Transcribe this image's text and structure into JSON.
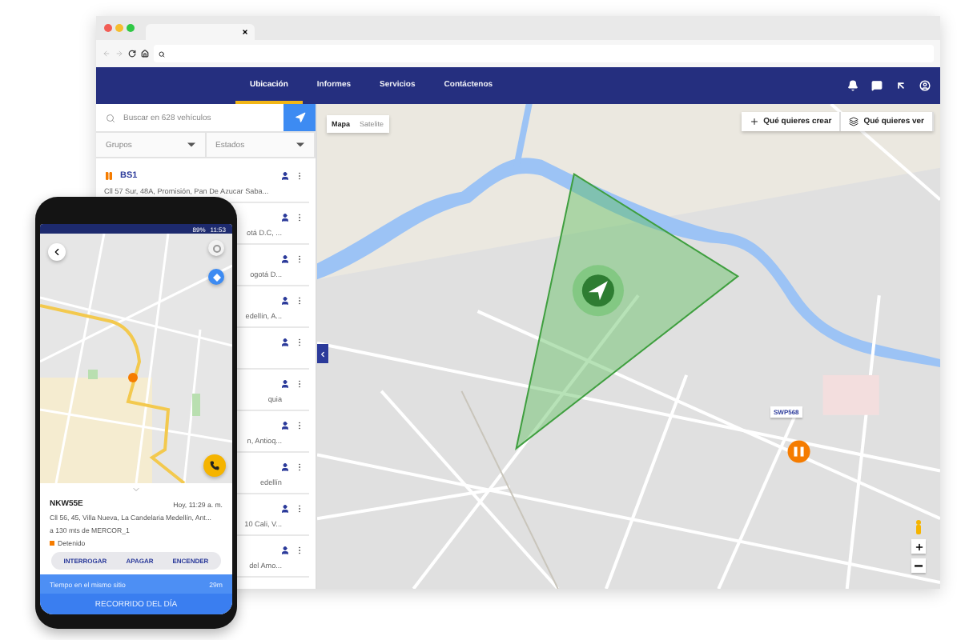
{
  "nav": {
    "items": [
      {
        "label": "Ubicación",
        "selected": true
      },
      {
        "label": "Informes",
        "selected": false
      },
      {
        "label": "Servicios",
        "selected": false
      },
      {
        "label": "Contáctenos",
        "selected": false
      }
    ]
  },
  "sidebar": {
    "search": {
      "placeholder": "Buscar en 628 vehículos"
    },
    "filters": [
      "Grupos",
      "Estados"
    ],
    "vehicles": [
      {
        "kind": "named",
        "name": "BS1",
        "address": "Cll 57 Sur, 48A, Promisión, Pan De Azucar Saba..."
      },
      {
        "kind": "covered",
        "address": "otá D.C, ..."
      },
      {
        "kind": "covered",
        "address": "ogotá D..."
      },
      {
        "kind": "covered",
        "address": "edellín, A..."
      },
      {
        "kind": "covered"
      },
      {
        "kind": "covered",
        "address": "quia"
      },
      {
        "kind": "covered",
        "address": "n, Antioq..."
      },
      {
        "kind": "covered",
        "address": "edellín"
      },
      {
        "kind": "covered",
        "address": "10 Cali, V..."
      },
      {
        "kind": "covered",
        "address": "del Amo..."
      }
    ]
  },
  "map": {
    "modes": [
      {
        "label": "Mapa",
        "selected": true
      },
      {
        "label": "Satelite",
        "selected": false
      }
    ],
    "actions": [
      {
        "kind": "create",
        "label": "Qué quieres crear"
      },
      {
        "kind": "view",
        "label": "Qué quieres ver"
      }
    ],
    "marker_label": "SWP568"
  },
  "phone": {
    "status": {
      "battery": "89%",
      "time": "11:53"
    },
    "vehicle": {
      "plate": "NKW55E",
      "time": "Hoy, 11:29 a. m.",
      "address": "Cll 56, 45, Villa Nueva, La Candelaria Medellín, Ant...",
      "distance": "a 130 mts de MERCOR_1",
      "state": "Detenido"
    },
    "actions": [
      "INTERROGAR",
      "APAGAR",
      "ENCENDER"
    ],
    "dwell": {
      "label": "Tiempo en el mismo sitio",
      "value": "29m"
    },
    "footer": "RECORRIDO DEL DÍA"
  }
}
